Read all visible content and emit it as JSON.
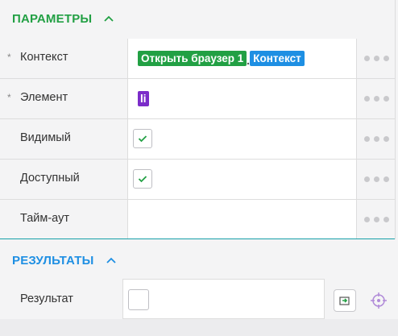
{
  "parameters": {
    "title": "ПАРАМЕТРЫ",
    "title_color": "#22a044",
    "rows": [
      {
        "label": "Контекст",
        "required_mark": "*",
        "chips": [
          {
            "text": "Открыть браузер 1",
            "color": "#22a044"
          },
          {
            "text": "Контекст",
            "color": "#1e8fe3"
          }
        ]
      },
      {
        "label": "Элемент",
        "required_mark": "*",
        "chips": [
          {
            "text": "li",
            "color": "#7b2cc9"
          }
        ]
      },
      {
        "label": "Видимый",
        "checked": true
      },
      {
        "label": "Доступный",
        "checked": true
      },
      {
        "label": "Тайм-аут",
        "value": ""
      }
    ],
    "more_icon": "more-dots-icon"
  },
  "results": {
    "title": "РЕЗУЛЬТАТЫ",
    "title_color": "#1e8fe3",
    "rows": [
      {
        "label": "Результат",
        "value": ""
      }
    ],
    "icons": [
      "variable-picker-icon",
      "target-crosshair-icon"
    ]
  },
  "colors": {
    "green": "#22a044",
    "blue": "#1e8fe3",
    "teal_divider": "#16a0a8"
  }
}
